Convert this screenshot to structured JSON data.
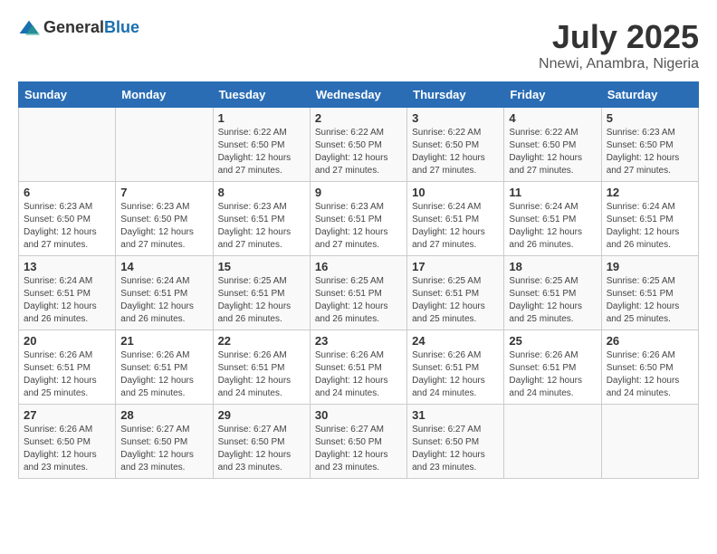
{
  "logo": {
    "general": "General",
    "blue": "Blue"
  },
  "title": "July 2025",
  "location": "Nnewi, Anambra, Nigeria",
  "days_of_week": [
    "Sunday",
    "Monday",
    "Tuesday",
    "Wednesday",
    "Thursday",
    "Friday",
    "Saturday"
  ],
  "weeks": [
    [
      {
        "day": "",
        "info": ""
      },
      {
        "day": "",
        "info": ""
      },
      {
        "day": "1",
        "info": "Sunrise: 6:22 AM\nSunset: 6:50 PM\nDaylight: 12 hours and 27 minutes."
      },
      {
        "day": "2",
        "info": "Sunrise: 6:22 AM\nSunset: 6:50 PM\nDaylight: 12 hours and 27 minutes."
      },
      {
        "day": "3",
        "info": "Sunrise: 6:22 AM\nSunset: 6:50 PM\nDaylight: 12 hours and 27 minutes."
      },
      {
        "day": "4",
        "info": "Sunrise: 6:22 AM\nSunset: 6:50 PM\nDaylight: 12 hours and 27 minutes."
      },
      {
        "day": "5",
        "info": "Sunrise: 6:23 AM\nSunset: 6:50 PM\nDaylight: 12 hours and 27 minutes."
      }
    ],
    [
      {
        "day": "6",
        "info": "Sunrise: 6:23 AM\nSunset: 6:50 PM\nDaylight: 12 hours and 27 minutes."
      },
      {
        "day": "7",
        "info": "Sunrise: 6:23 AM\nSunset: 6:50 PM\nDaylight: 12 hours and 27 minutes."
      },
      {
        "day": "8",
        "info": "Sunrise: 6:23 AM\nSunset: 6:51 PM\nDaylight: 12 hours and 27 minutes."
      },
      {
        "day": "9",
        "info": "Sunrise: 6:23 AM\nSunset: 6:51 PM\nDaylight: 12 hours and 27 minutes."
      },
      {
        "day": "10",
        "info": "Sunrise: 6:24 AM\nSunset: 6:51 PM\nDaylight: 12 hours and 27 minutes."
      },
      {
        "day": "11",
        "info": "Sunrise: 6:24 AM\nSunset: 6:51 PM\nDaylight: 12 hours and 26 minutes."
      },
      {
        "day": "12",
        "info": "Sunrise: 6:24 AM\nSunset: 6:51 PM\nDaylight: 12 hours and 26 minutes."
      }
    ],
    [
      {
        "day": "13",
        "info": "Sunrise: 6:24 AM\nSunset: 6:51 PM\nDaylight: 12 hours and 26 minutes."
      },
      {
        "day": "14",
        "info": "Sunrise: 6:24 AM\nSunset: 6:51 PM\nDaylight: 12 hours and 26 minutes."
      },
      {
        "day": "15",
        "info": "Sunrise: 6:25 AM\nSunset: 6:51 PM\nDaylight: 12 hours and 26 minutes."
      },
      {
        "day": "16",
        "info": "Sunrise: 6:25 AM\nSunset: 6:51 PM\nDaylight: 12 hours and 26 minutes."
      },
      {
        "day": "17",
        "info": "Sunrise: 6:25 AM\nSunset: 6:51 PM\nDaylight: 12 hours and 25 minutes."
      },
      {
        "day": "18",
        "info": "Sunrise: 6:25 AM\nSunset: 6:51 PM\nDaylight: 12 hours and 25 minutes."
      },
      {
        "day": "19",
        "info": "Sunrise: 6:25 AM\nSunset: 6:51 PM\nDaylight: 12 hours and 25 minutes."
      }
    ],
    [
      {
        "day": "20",
        "info": "Sunrise: 6:26 AM\nSunset: 6:51 PM\nDaylight: 12 hours and 25 minutes."
      },
      {
        "day": "21",
        "info": "Sunrise: 6:26 AM\nSunset: 6:51 PM\nDaylight: 12 hours and 25 minutes."
      },
      {
        "day": "22",
        "info": "Sunrise: 6:26 AM\nSunset: 6:51 PM\nDaylight: 12 hours and 24 minutes."
      },
      {
        "day": "23",
        "info": "Sunrise: 6:26 AM\nSunset: 6:51 PM\nDaylight: 12 hours and 24 minutes."
      },
      {
        "day": "24",
        "info": "Sunrise: 6:26 AM\nSunset: 6:51 PM\nDaylight: 12 hours and 24 minutes."
      },
      {
        "day": "25",
        "info": "Sunrise: 6:26 AM\nSunset: 6:51 PM\nDaylight: 12 hours and 24 minutes."
      },
      {
        "day": "26",
        "info": "Sunrise: 6:26 AM\nSunset: 6:50 PM\nDaylight: 12 hours and 24 minutes."
      }
    ],
    [
      {
        "day": "27",
        "info": "Sunrise: 6:26 AM\nSunset: 6:50 PM\nDaylight: 12 hours and 23 minutes."
      },
      {
        "day": "28",
        "info": "Sunrise: 6:27 AM\nSunset: 6:50 PM\nDaylight: 12 hours and 23 minutes."
      },
      {
        "day": "29",
        "info": "Sunrise: 6:27 AM\nSunset: 6:50 PM\nDaylight: 12 hours and 23 minutes."
      },
      {
        "day": "30",
        "info": "Sunrise: 6:27 AM\nSunset: 6:50 PM\nDaylight: 12 hours and 23 minutes."
      },
      {
        "day": "31",
        "info": "Sunrise: 6:27 AM\nSunset: 6:50 PM\nDaylight: 12 hours and 23 minutes."
      },
      {
        "day": "",
        "info": ""
      },
      {
        "day": "",
        "info": ""
      }
    ]
  ]
}
